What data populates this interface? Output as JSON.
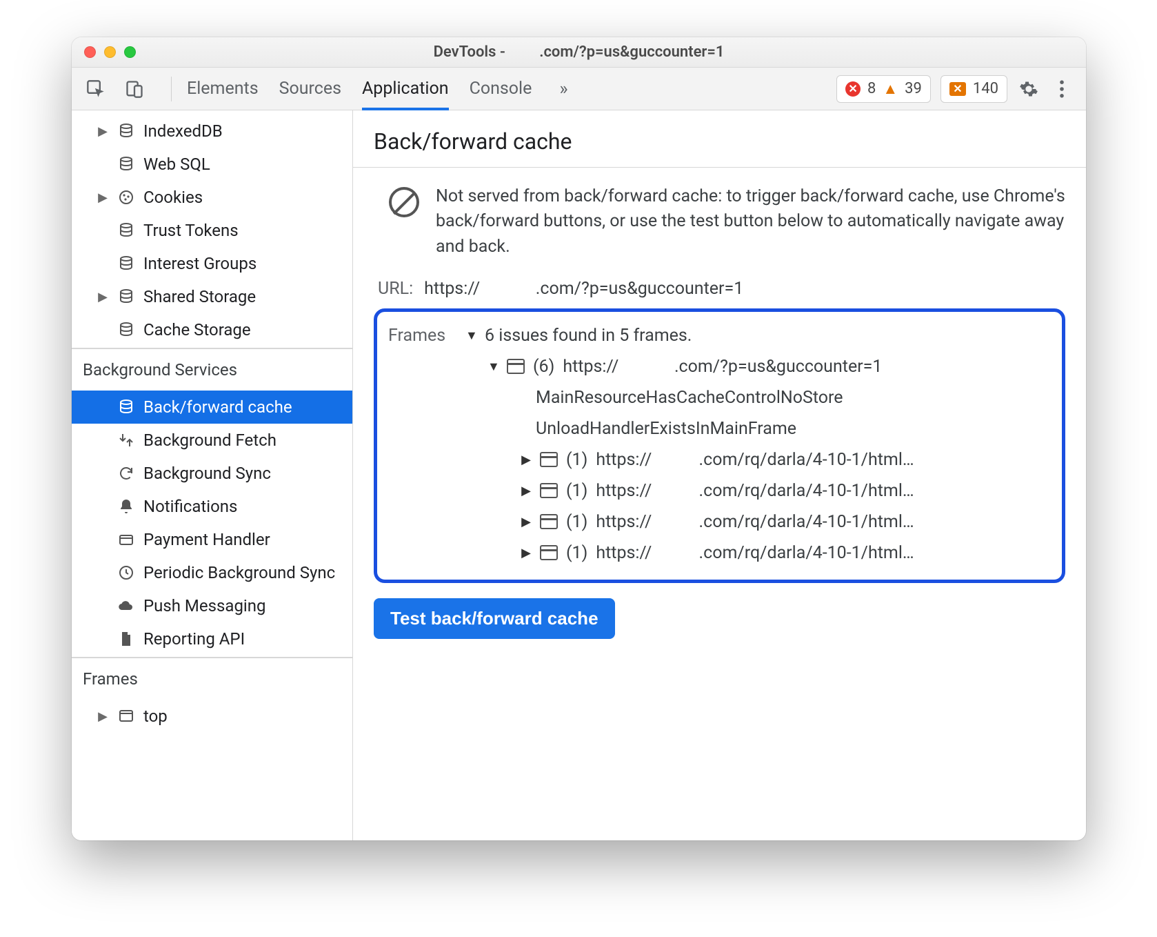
{
  "window": {
    "title_left": "DevTools -",
    "title_right": ".com/?p=us&guccounter=1"
  },
  "toolbar": {
    "tabs": [
      "Elements",
      "Sources",
      "Application",
      "Console"
    ],
    "active_tab": "Application",
    "overflow_glyph": "»",
    "errors": "8",
    "warnings": "39",
    "messages": "140"
  },
  "sidebar": {
    "storage": [
      {
        "tri": "▶",
        "icon": "db",
        "label": "IndexedDB"
      },
      {
        "tri": "",
        "icon": "db",
        "label": "Web SQL"
      },
      {
        "tri": "▶",
        "icon": "cookie",
        "label": "Cookies"
      },
      {
        "tri": "",
        "icon": "db",
        "label": "Trust Tokens"
      },
      {
        "tri": "",
        "icon": "db",
        "label": "Interest Groups"
      },
      {
        "tri": "▶",
        "icon": "db",
        "label": "Shared Storage"
      },
      {
        "tri": "",
        "icon": "db",
        "label": "Cache Storage"
      }
    ],
    "bg_heading": "Background Services",
    "bg": [
      {
        "icon": "db",
        "label": "Back/forward cache",
        "selected": true
      },
      {
        "icon": "fetch",
        "label": "Background Fetch"
      },
      {
        "icon": "sync",
        "label": "Background Sync"
      },
      {
        "icon": "bell",
        "label": "Notifications"
      },
      {
        "icon": "card",
        "label": "Payment Handler"
      },
      {
        "icon": "clock",
        "label": "Periodic Background Sync"
      },
      {
        "icon": "cloud",
        "label": "Push Messaging"
      },
      {
        "icon": "file",
        "label": "Reporting API"
      }
    ],
    "frames_heading": "Frames",
    "frames": [
      {
        "tri": "▶",
        "icon": "frame",
        "label": "top"
      }
    ]
  },
  "panel": {
    "heading": "Back/forward cache",
    "notice": "Not served from back/forward cache: to trigger back/forward cache, use Chrome's back/forward buttons, or use the test button below to automatically navigate away and back.",
    "url_label": "URL:",
    "url_value": "https://             .com/?p=us&guccounter=1",
    "frames_label": "Frames",
    "frames_summary": "6 issues found in 5 frames.",
    "root": {
      "count": "(6)",
      "url": "https://             .com/?p=us&guccounter=1",
      "reasons": [
        "MainResourceHasCacheControlNoStore",
        "UnloadHandlerExistsInMainFrame"
      ],
      "children": [
        {
          "count": "(1)",
          "url": "https://           .com/rq/darla/4-10-1/html…"
        },
        {
          "count": "(1)",
          "url": "https://           .com/rq/darla/4-10-1/html…"
        },
        {
          "count": "(1)",
          "url": "https://           .com/rq/darla/4-10-1/html…"
        },
        {
          "count": "(1)",
          "url": "https://           .com/rq/darla/4-10-1/html…"
        }
      ]
    },
    "test_button": "Test back/forward cache"
  }
}
